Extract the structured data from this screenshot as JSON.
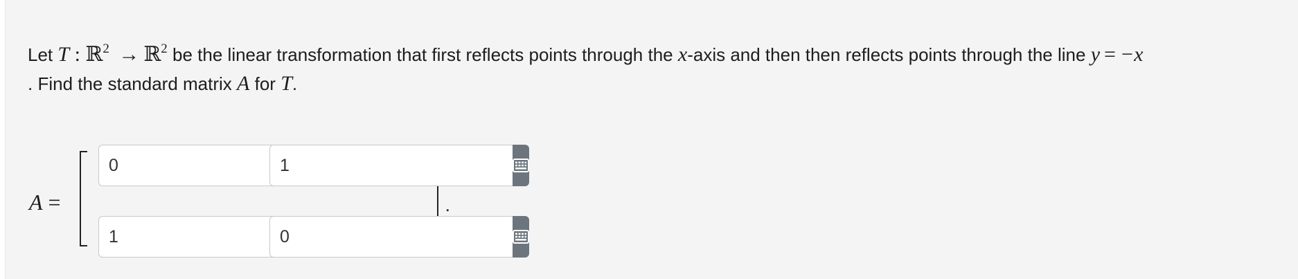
{
  "question": {
    "prefix": "Let",
    "T": "T",
    "colon": ":",
    "R": "ℝ",
    "exp": "2",
    "arrow": "→",
    "text1": "be the linear transformation that first reflects points through the",
    "x_var": "x",
    "text2": "-axis and then then reflects points through the line",
    "line_y": "y",
    "eq": "=",
    "line_neg_x": "−x",
    "text3": ". Find the standard matrix",
    "A_var": "A",
    "text4": "for",
    "T_end": "T",
    "period": "."
  },
  "matrix": {
    "label_var": "A",
    "label_eq": "=",
    "entries": [
      {
        "value": "0"
      },
      {
        "value": "1"
      },
      {
        "value": "1"
      },
      {
        "value": "0"
      }
    ],
    "trailing": ".",
    "keyboard_icon": "keyboard-icon",
    "button_color": "#6c757d"
  }
}
